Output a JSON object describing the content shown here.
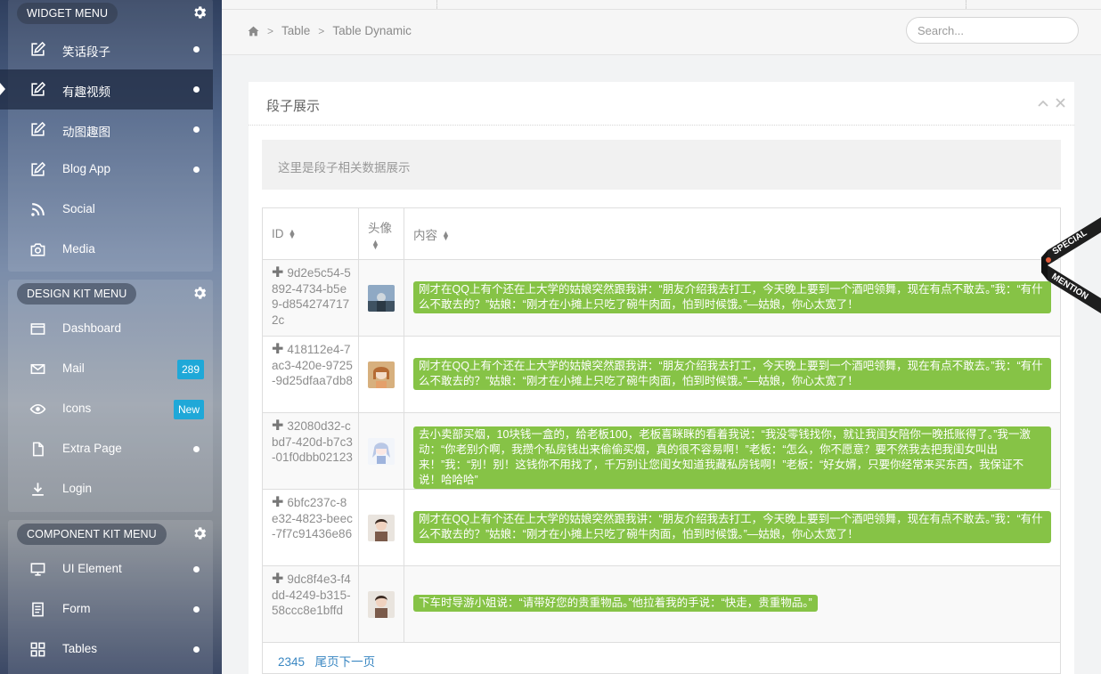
{
  "sidebar": {
    "groups": [
      {
        "title": "WIDGET MENU",
        "items": [
          {
            "label": "笑话段子",
            "icon": "edit-icon"
          },
          {
            "label": "有趣视频",
            "icon": "edit-icon",
            "active": true
          },
          {
            "label": "动图趣图",
            "icon": "edit-icon"
          },
          {
            "label": "Blog App",
            "icon": "edit-icon"
          },
          {
            "label": "Social",
            "icon": "rss-icon"
          },
          {
            "label": "Media",
            "icon": "camera-icon"
          }
        ]
      },
      {
        "title": "DESIGN KIT MENU",
        "items": [
          {
            "label": "Dashboard",
            "icon": "browser-window-icon"
          },
          {
            "label": "Mail",
            "icon": "envelope-icon",
            "badge": "289"
          },
          {
            "label": "Icons",
            "icon": "eye-icon",
            "badge": "New"
          },
          {
            "label": "Extra Page",
            "icon": "file-icon"
          },
          {
            "label": "Login",
            "icon": "download-icon"
          }
        ]
      },
      {
        "title": "COMPONENT KIT MENU",
        "items": [
          {
            "label": "UI Element",
            "icon": "monitor-icon"
          },
          {
            "label": "Form",
            "icon": "form-list-icon"
          },
          {
            "label": "Tables",
            "icon": "grid-icon"
          }
        ]
      }
    ]
  },
  "breadcrumb": {
    "items": [
      "Table",
      "Table Dynamic"
    ]
  },
  "search": {
    "placeholder": "Search..."
  },
  "panel": {
    "title": "段子展示",
    "notice": "这里是段子相关数据展示"
  },
  "table": {
    "headers": {
      "id": "ID",
      "avatar": "头像",
      "content": "内容"
    },
    "rows": [
      {
        "id": "9d2e5c54-5892-4734-b5e9-d8542747172c",
        "content": "刚才在QQ上有个还在上大学的姑娘突然跟我讲：“朋友介绍我去打工，今天晚上要到一个酒吧领舞，现在有点不敢去。”我：“有什么不敢去的？”姑娘：“刚才在小摊上只吃了碗牛肉面，怕到时候饿。”—姑娘，你心太宽了！"
      },
      {
        "id": "418112e4-7ac3-420e-9725-9d25dfaa7db8",
        "content": "刚才在QQ上有个还在上大学的姑娘突然跟我讲：“朋友介绍我去打工，今天晚上要到一个酒吧领舞，现在有点不敢去。”我：“有什么不敢去的？”姑娘：“刚才在小摊上只吃了碗牛肉面，怕到时候饿。”—姑娘，你心太宽了！"
      },
      {
        "id": "32080d32-cbd7-420d-b7c3-01f0dbb02123",
        "content": "去小卖部买烟，10块钱一盒的，给老板100，老板喜眯眯的看着我说：“我没零钱找你，就让我闺女陪你一晚抵账得了。”我一激动：“你老别介啊，我攒个私房钱出来偷偷买烟，真的很不容易啊！”老板：“怎么，你不愿意？要不然我去把我闺女叫出来！”我：“别！别！这钱你不用找了，千万别让您闺女知道我藏私房钱啊！”老板：“好女婿，只要你经常来买东西，我保证不说！哈哈哈”"
      },
      {
        "id": "6bfc237c-8e32-4823-beec-7f7c91436e86",
        "content": "刚才在QQ上有个还在上大学的姑娘突然跟我讲：“朋友介绍我去打工，今天晚上要到一个酒吧领舞，现在有点不敢去。”我：“有什么不敢去的？”姑娘：“刚才在小摊上只吃了碗牛肉面，怕到时候饿。”—姑娘，你心太宽了！"
      },
      {
        "id": "9dc8f4e3-f4dd-4249-b315-58ccc8e1bffd",
        "content": "下车时导游小姐说：“请带好您的贵重物品。”他拉着我的手说：“快走，贵重物品。”"
      }
    ],
    "pagination": {
      "pages": "2345",
      "last_next": "尾页下一页"
    }
  },
  "ribbon": {
    "line1": "SPECIAL",
    "line2": "MENTION"
  },
  "colors": {
    "accent_green": "#86c346",
    "badge_blue": "#1fa8d8",
    "link_blue": "#3a87c2"
  }
}
